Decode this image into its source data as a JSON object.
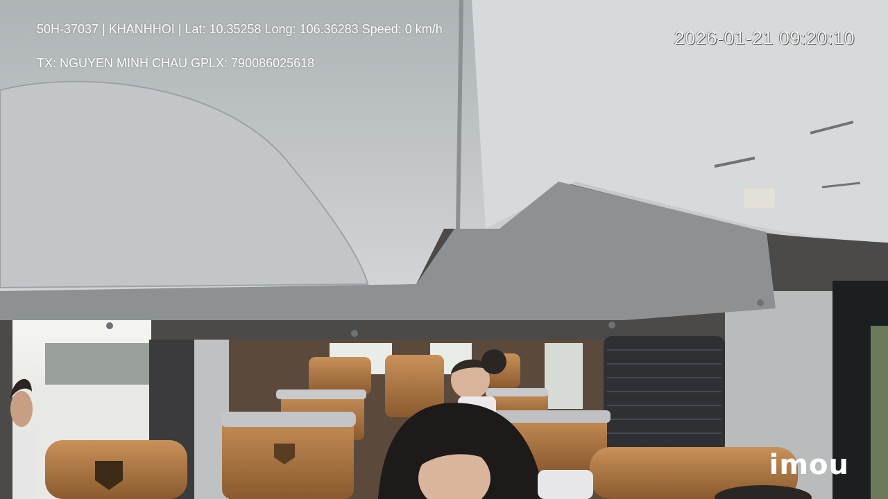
{
  "overlay": {
    "line1": "50H-37037 | KHANHHOI | Lat: 10.35258 Long: 106.36283 Speed: 0 km/h",
    "line2": "TX: NGUYEN MINH CHAU GPLX: 790086025618",
    "timestamp": "2026-01-21 09:20:10",
    "logo": "imou"
  },
  "scene": {
    "description_icon": "van-interior-camera-view",
    "colors": {
      "ceiling": "#c9cdd0",
      "headliner_panel": "#8d9193",
      "seat_leather": "#b07a45",
      "seat_dark": "#6a4424",
      "window_light": "#eef0ec"
    }
  }
}
